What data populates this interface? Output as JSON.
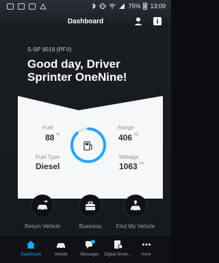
{
  "status_bar": {
    "battery_percent": "75%",
    "time": "13:09"
  },
  "header": {
    "title": "Dashboard",
    "icons": {
      "profile": "user-icon",
      "info": "info-icon"
    }
  },
  "vehicle": {
    "plate": "S-SP 9019 (PFV)"
  },
  "greeting": "Good day, Driver Sprinter OneNine!",
  "stats": {
    "fuel": {
      "label": "Fuel",
      "value": "88",
      "unit": "%",
      "level_percent": 88
    },
    "range": {
      "label": "Range",
      "value": "406",
      "unit": "mi"
    },
    "fuel_type": {
      "label": "Fuel Type",
      "value": "Diesel"
    },
    "mileage": {
      "label": "Mileage",
      "value": "1063",
      "unit": "mi"
    }
  },
  "actions": [
    {
      "label": "Return Vehicle",
      "icon": "car-return-icon"
    },
    {
      "label": "Business",
      "icon": "briefcase-icon"
    },
    {
      "label": "Find My Vehicle",
      "icon": "car-location-icon"
    }
  ],
  "bottom_nav": [
    {
      "label": "Dashboard",
      "icon": "home-icon",
      "active": true
    },
    {
      "label": "Vehicle",
      "icon": "car-icon",
      "active": false
    },
    {
      "label": "Messages",
      "icon": "messages-icon",
      "active": false,
      "badge": "!"
    },
    {
      "label": "Digital Driver...",
      "icon": "document-icon",
      "active": false
    },
    {
      "label": "more",
      "icon": "more-icon",
      "active": false
    }
  ],
  "colors": {
    "accent": "#1ea7ff",
    "panel": "#f6f7f8",
    "background": "#15181c"
  }
}
